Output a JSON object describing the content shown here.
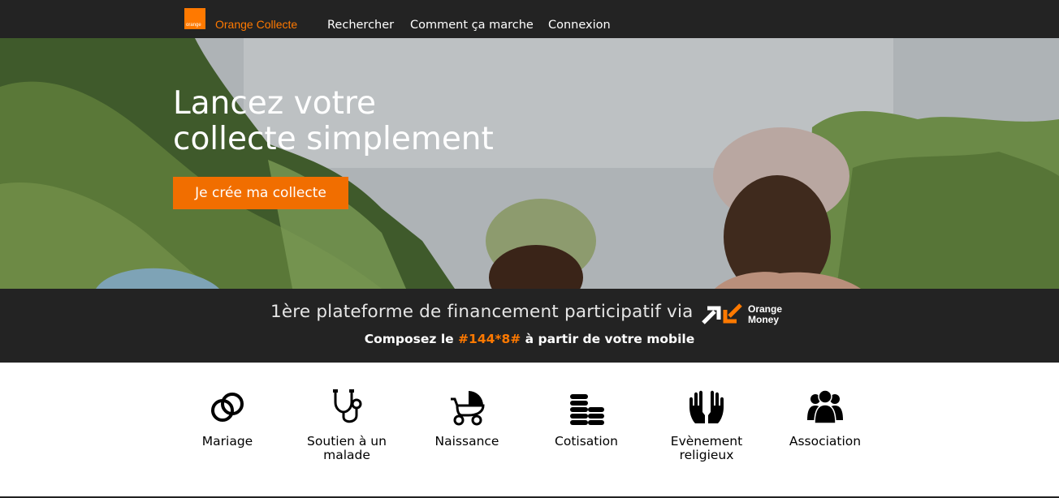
{
  "header": {
    "logo_text": "orange",
    "brand": "Orange Collecte",
    "nav": [
      "Rechercher",
      "Comment ça marche",
      "Connexion"
    ]
  },
  "hero": {
    "title_line1": "Lancez votre",
    "title_line2": "collecte simplement",
    "cta": "Je crée ma collecte"
  },
  "banner": {
    "headline": "1ère plateforme de financement participatif via",
    "orange_money_line1": "Orange",
    "orange_money_line2": "Money",
    "sub_prefix": "Composez le ",
    "sub_code": "#144*8#",
    "sub_suffix": " à partir de votre mobile"
  },
  "categories": [
    {
      "label": "Mariage",
      "icon": "rings-icon"
    },
    {
      "label": "Soutien à un malade",
      "icon": "stethoscope-icon"
    },
    {
      "label": "Naissance",
      "icon": "stroller-icon"
    },
    {
      "label": "Cotisation",
      "icon": "coins-icon"
    },
    {
      "label": "Evènement religieux",
      "icon": "praying-hands-icon"
    },
    {
      "label": "Association",
      "icon": "group-icon"
    }
  ],
  "colors": {
    "brand_orange": "#ff7900",
    "cta_orange": "#f16e00",
    "dark_bar": "#232323"
  }
}
